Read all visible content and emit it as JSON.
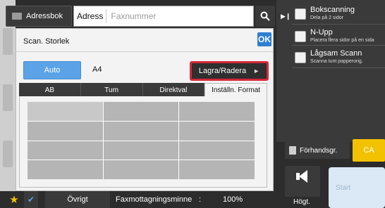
{
  "addressbar": {
    "addressbook_label": "Adressbok",
    "address_label": "Adress",
    "fax_placeholder": "Faxnummer"
  },
  "dialog": {
    "title": "Scan. Storlek",
    "ok_label": "OK",
    "auto_label": "Auto",
    "selected_size": "A4",
    "save_delete_label": "Lagra/Radera",
    "tabs": [
      "AB",
      "Tum",
      "Direktval",
      "Inställn. Format"
    ],
    "active_tab": "Inställn. Format"
  },
  "right_panel": {
    "items": [
      {
        "title": "Bokscanning",
        "subtitle": "Dela på 2 sidor",
        "checked": false
      },
      {
        "title": "N-Upp",
        "subtitle": "Placera flera sidor på en sida",
        "checked": false
      },
      {
        "title": "Lågsam Scann",
        "subtitle": "Scanna tunt papperorig.",
        "checked": false
      }
    ],
    "preview_label": "Förhandsgr.",
    "ca_label": "CA",
    "volume_label": "Högt.",
    "start_label": "Start"
  },
  "bottombar": {
    "other_label": "Övrigt",
    "fax_memory_label": "Faxmottagningsminne",
    "fax_memory_separator": ":",
    "fax_memory_value": "100%"
  },
  "colors": {
    "accent_blue": "#2d7fd2",
    "highlight_red": "#d6283a",
    "ca_yellow": "#f2c200"
  }
}
